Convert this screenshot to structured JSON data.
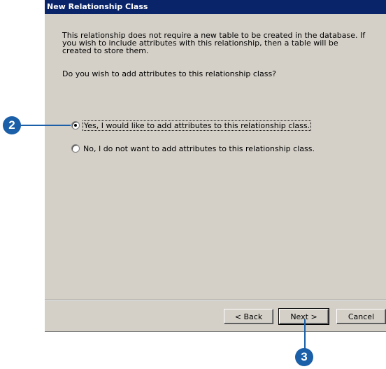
{
  "window": {
    "title": "New Relationship Class"
  },
  "content": {
    "description": "This relationship does not require a new table to be created in the database. If you wish to include attributes with this relationship, then a table will be created to store them.",
    "question": "Do you wish to add attributes to this relationship class?"
  },
  "options": [
    {
      "label": "Yes, I would like to add attributes to this relationship class.",
      "checked": true
    },
    {
      "label": "No, I do not want to add attributes to this relationship class.",
      "checked": false
    }
  ],
  "buttons": {
    "back": "< Back",
    "next": "Next >",
    "cancel": "Cancel"
  },
  "callouts": {
    "step_options": "2",
    "step_next": "3"
  },
  "colors": {
    "callout": "#1a5fa8",
    "titlebar": "#0a246a",
    "dialog": "#d4d0c8"
  }
}
